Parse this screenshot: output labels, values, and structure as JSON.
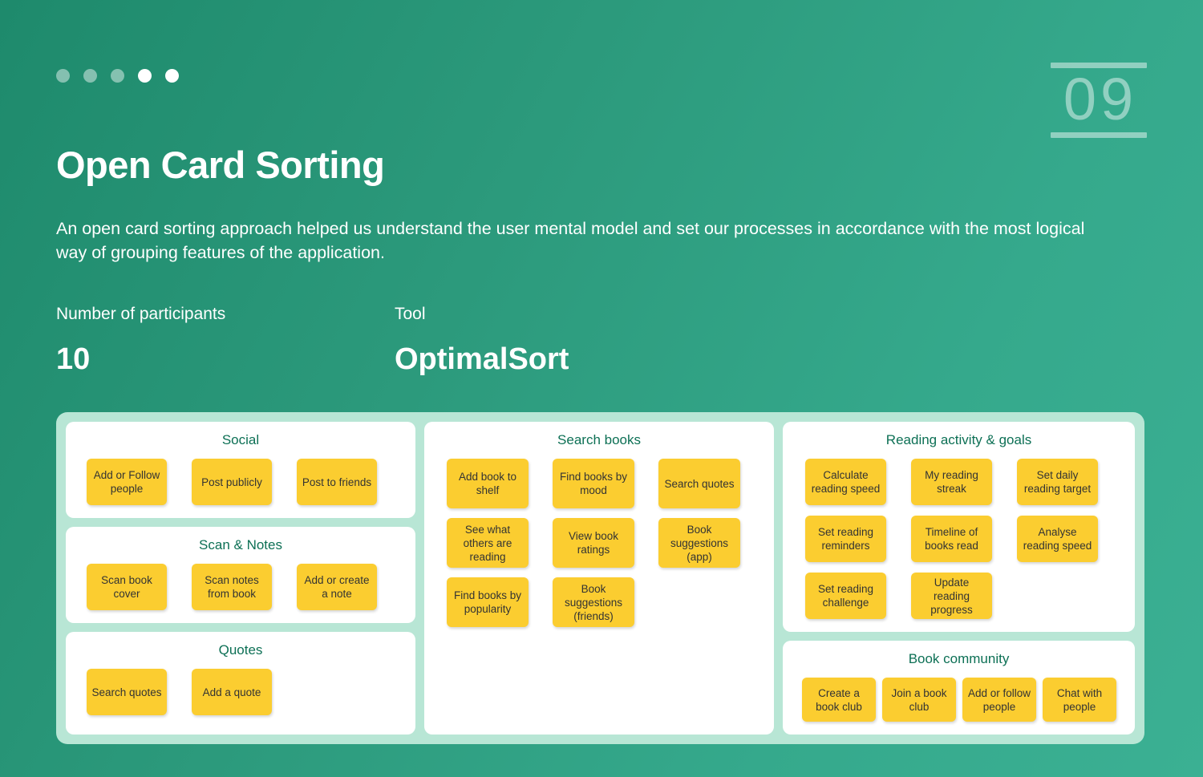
{
  "header": {
    "dots": [
      {
        "state": "dim"
      },
      {
        "state": "dim"
      },
      {
        "state": "dim"
      },
      {
        "state": "solid"
      },
      {
        "state": "solid"
      }
    ],
    "page_number": "09",
    "title": "Open Card Sorting",
    "description": "An open card sorting approach helped us understand the user mental model and set our processes in accordance with the most logical way of grouping features of the application."
  },
  "stats": [
    {
      "label": "Number of participants",
      "value": "10"
    },
    {
      "label": "Tool",
      "value": "OptimalSort"
    }
  ],
  "board": {
    "columns": [
      {
        "name": "left",
        "groups": [
          {
            "title": "Social",
            "cards": [
              "Add or Follow people",
              "Post publicly",
              "Post to friends"
            ]
          },
          {
            "title": "Scan & Notes",
            "cards": [
              "Scan book cover",
              "Scan notes from book",
              "Add or create a note"
            ]
          },
          {
            "title": "Quotes",
            "cards": [
              "Search quotes",
              "Add a quote"
            ]
          }
        ]
      },
      {
        "name": "middle",
        "groups": [
          {
            "title": "Search books",
            "cards": [
              "Add book to shelf",
              "Find books by mood",
              "Search quotes",
              "See what others are reading",
              "View book ratings",
              "Book suggestions (app)",
              "Find books by popularity",
              "Book suggestions (friends)"
            ]
          }
        ]
      },
      {
        "name": "right",
        "groups": [
          {
            "title": "Reading activity & goals",
            "cards": [
              "Calculate reading speed",
              "My reading streak",
              "Set daily reading target",
              "Set reading reminders",
              "Timeline of books read",
              "Analyse reading speed",
              "Set reading challenge",
              "Update reading progress"
            ]
          },
          {
            "title": "Book community",
            "cards": [
              "Create a book club",
              "Join a book club",
              "Add or follow people",
              "Chat with people"
            ]
          }
        ]
      }
    ]
  },
  "colors": {
    "background_dark": "#1e8a6c",
    "background_light": "#3bb093",
    "board_surface": "#b8e6d5",
    "panel": "#ffffff",
    "card_yellow": "#fbcd30",
    "group_heading": "#0d7055",
    "card_text": "#333333",
    "text_on_green": "#ffffff"
  }
}
